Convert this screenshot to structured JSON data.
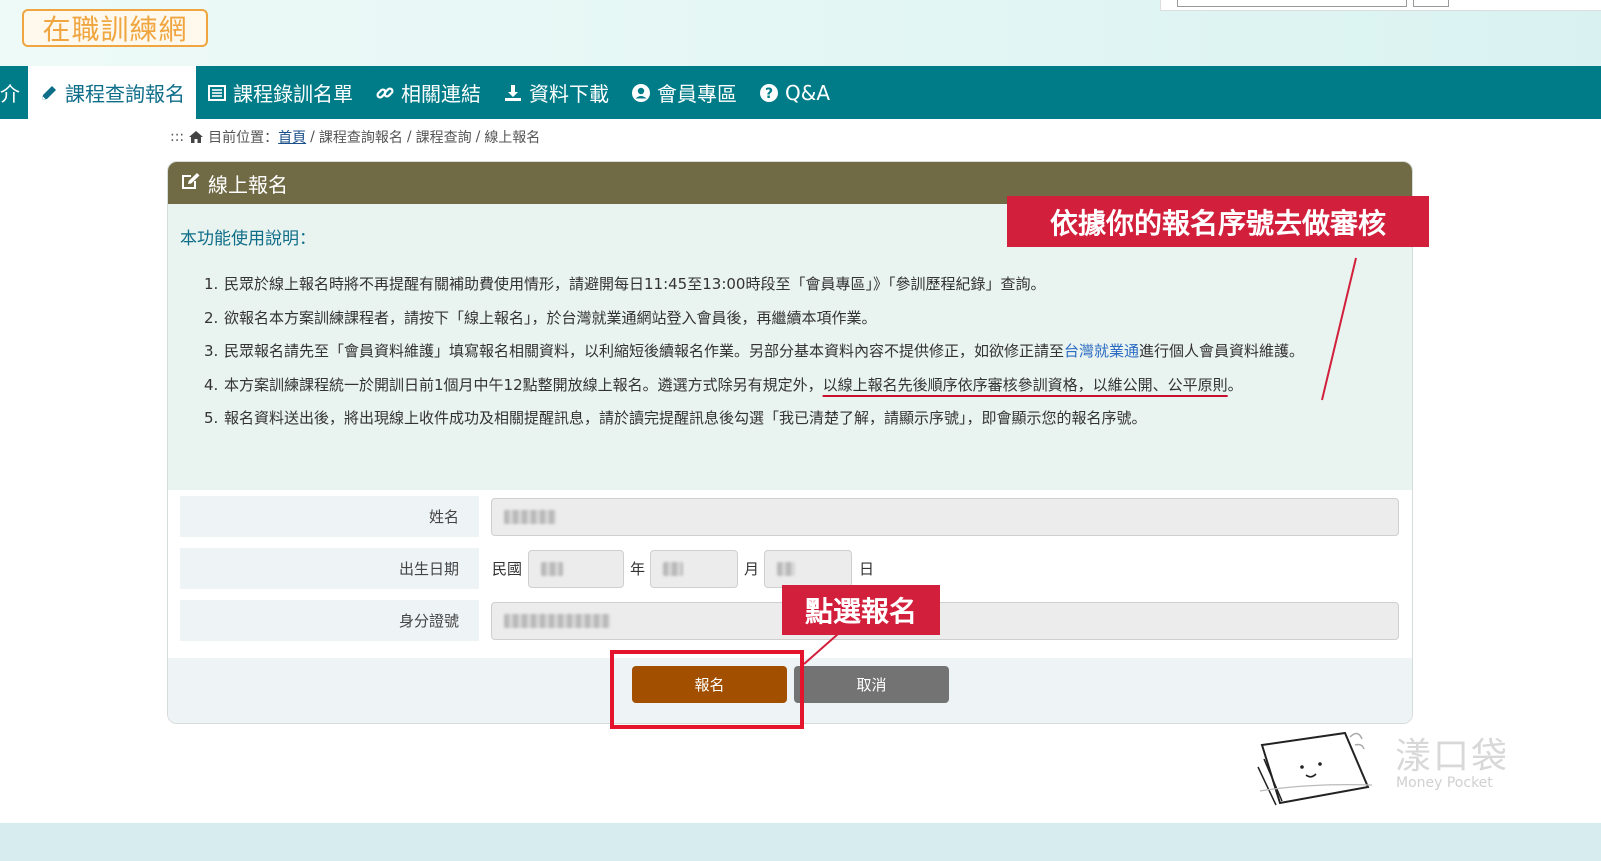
{
  "header": {
    "logo_text": "在職訓練網"
  },
  "nav": {
    "partial_item": "介",
    "items": [
      {
        "label": "課程查詢報名",
        "icon": "pencil-icon",
        "active": true
      },
      {
        "label": "課程錄訓名單",
        "icon": "list-icon",
        "active": false
      },
      {
        "label": "相關連結",
        "icon": "link-icon",
        "active": false
      },
      {
        "label": "資料下載",
        "icon": "download-icon",
        "active": false
      },
      {
        "label": "會員專區",
        "icon": "user-icon",
        "active": false
      },
      {
        "label": "Q&A",
        "icon": "question-icon",
        "active": false
      }
    ]
  },
  "breadcrumb": {
    "prefix": ":::",
    "current_label": "目前位置：",
    "home": "首頁",
    "path": [
      "課程查詢報名",
      "課程查詢",
      "線上報名"
    ],
    "separator": "/"
  },
  "panel": {
    "title": "線上報名",
    "instructions_title": "本功能使用說明：",
    "instructions": [
      {
        "num": "1.",
        "text": "民眾於線上報名時將不再提醒有關補助費使用情形，請避開每日11:45至13:00時段至「會員專區」》「參訓歷程紀錄」查詢。"
      },
      {
        "num": "2.",
        "text": "欲報名本方案訓練課程者，請按下「線上報名」，於台灣就業通網站登入會員後，再繼續本項作業。"
      },
      {
        "num": "3.",
        "text_before": "民眾報名請先至「會員資料維護」填寫報名相關資料，以利縮短後續報名作業。另部分基本資料內容不提供修正，如欲修正請至",
        "link": "台灣就業通",
        "text_after": "進行個人會員資料維護。"
      },
      {
        "num": "4.",
        "text_before": "本方案訓練課程統一於開訓日前1個月中午12點整開放線上報名。遴選方式除另有規定外，",
        "underlined": "以線上報名先後順序依序審核參訓資格，以維公開、公平原則",
        "text_after": "。"
      },
      {
        "num": "5.",
        "text": "報名資料送出後，將出現線上收件成功及相關提醒訊息，請於讀完提醒訊息後勾選「我已清楚了解，請顯示序號」，即會顯示您的報名序號。"
      }
    ],
    "form": {
      "name_label": "姓名",
      "birth_label": "出生日期",
      "birth_era": "民國",
      "birth_year_unit": "年",
      "birth_month_unit": "月",
      "birth_day_unit": "日",
      "id_label": "身分證號"
    },
    "buttons": {
      "submit": "報名",
      "cancel": "取消"
    }
  },
  "annotations": {
    "review_note": "依據你的報名序號去做審核",
    "click_note": "點選報名",
    "accent_color": "#d21f3c"
  },
  "watermark": {
    "title": "漾口袋",
    "subtitle": "Money Pocket"
  },
  "colors": {
    "nav_bg": "#007c89",
    "panel_head": "#706a45",
    "submit_btn": "#a24f00",
    "cancel_btn": "#737373",
    "logo_orange": "#f0a640"
  }
}
